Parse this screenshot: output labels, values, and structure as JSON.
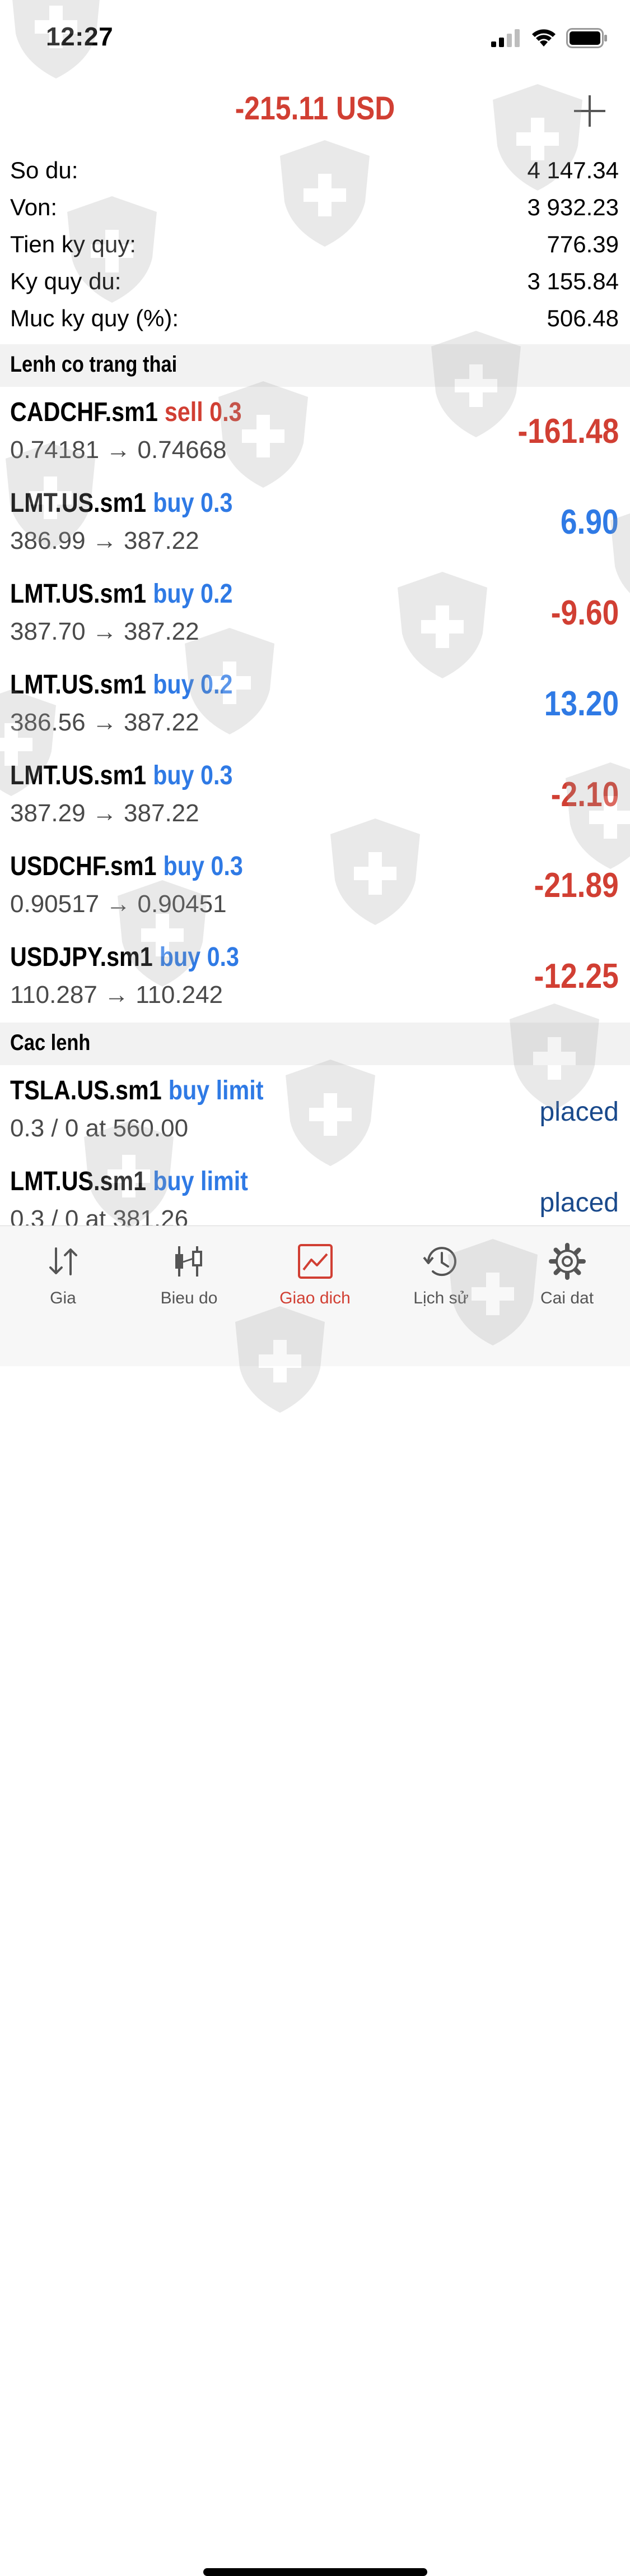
{
  "status_bar": {
    "time": "12:27"
  },
  "header": {
    "total_profit": "-215.11 USD",
    "add_icon": "plus-icon"
  },
  "summary": [
    {
      "label": "So du:",
      "value": "4 147.34"
    },
    {
      "label": "Von:",
      "value": "3 932.23"
    },
    {
      "label": "Tien ky quy:",
      "value": "776.39"
    },
    {
      "label": "Ky quy du:",
      "value": "3 155.84"
    },
    {
      "label": "Muc ky quy (%):",
      "value": "506.48"
    }
  ],
  "positions_section": {
    "title": "Lenh co trang thai"
  },
  "positions": [
    {
      "symbol": "CADCHF.sm1",
      "side": "sell 0.3",
      "prices": "0.74181 → 0.74668",
      "profit": "-161.48"
    },
    {
      "symbol": "LMT.US.sm1",
      "side": "buy 0.3",
      "prices": "386.99 → 387.22",
      "profit": "6.90"
    },
    {
      "symbol": "LMT.US.sm1",
      "side": "buy 0.2",
      "prices": "387.70 → 387.22",
      "profit": "-9.60"
    },
    {
      "symbol": "LMT.US.sm1",
      "side": "buy 0.2",
      "prices": "386.56 → 387.22",
      "profit": "13.20"
    },
    {
      "symbol": "LMT.US.sm1",
      "side": "buy 0.3",
      "prices": "387.29 → 387.22",
      "profit": "-2.10"
    },
    {
      "symbol": "USDCHF.sm1",
      "side": "buy 0.3",
      "prices": "0.90517 → 0.90451",
      "profit": "-21.89"
    },
    {
      "symbol": "USDJPY.sm1",
      "side": "buy 0.3",
      "prices": "110.287 → 110.242",
      "profit": "-12.25"
    }
  ],
  "orders_section": {
    "title": "Cac lenh"
  },
  "orders": [
    {
      "symbol": "TSLA.US.sm1",
      "type": "buy limit",
      "detail": "0.3 / 0 at 560.00",
      "status": "placed"
    },
    {
      "symbol": "LMT.US.sm1",
      "type": "buy limit",
      "detail": "0.3 / 0 at 381.26",
      "status": "placed"
    }
  ],
  "colors": {
    "loss": "#d13f33",
    "gain": "#2f7ae5",
    "placed": "#1a4a8c",
    "active_tab": "#d13f33"
  },
  "tabbar": [
    {
      "label": "Gia",
      "icon": "price-arrows-icon"
    },
    {
      "label": "Bieu do",
      "icon": "candlestick-chart-icon"
    },
    {
      "label": "Giao dich",
      "icon": "trade-chart-icon",
      "active": true
    },
    {
      "label": "Lịch sử",
      "icon": "history-clock-icon"
    },
    {
      "label": "Cai dat",
      "icon": "gear-icon"
    }
  ]
}
